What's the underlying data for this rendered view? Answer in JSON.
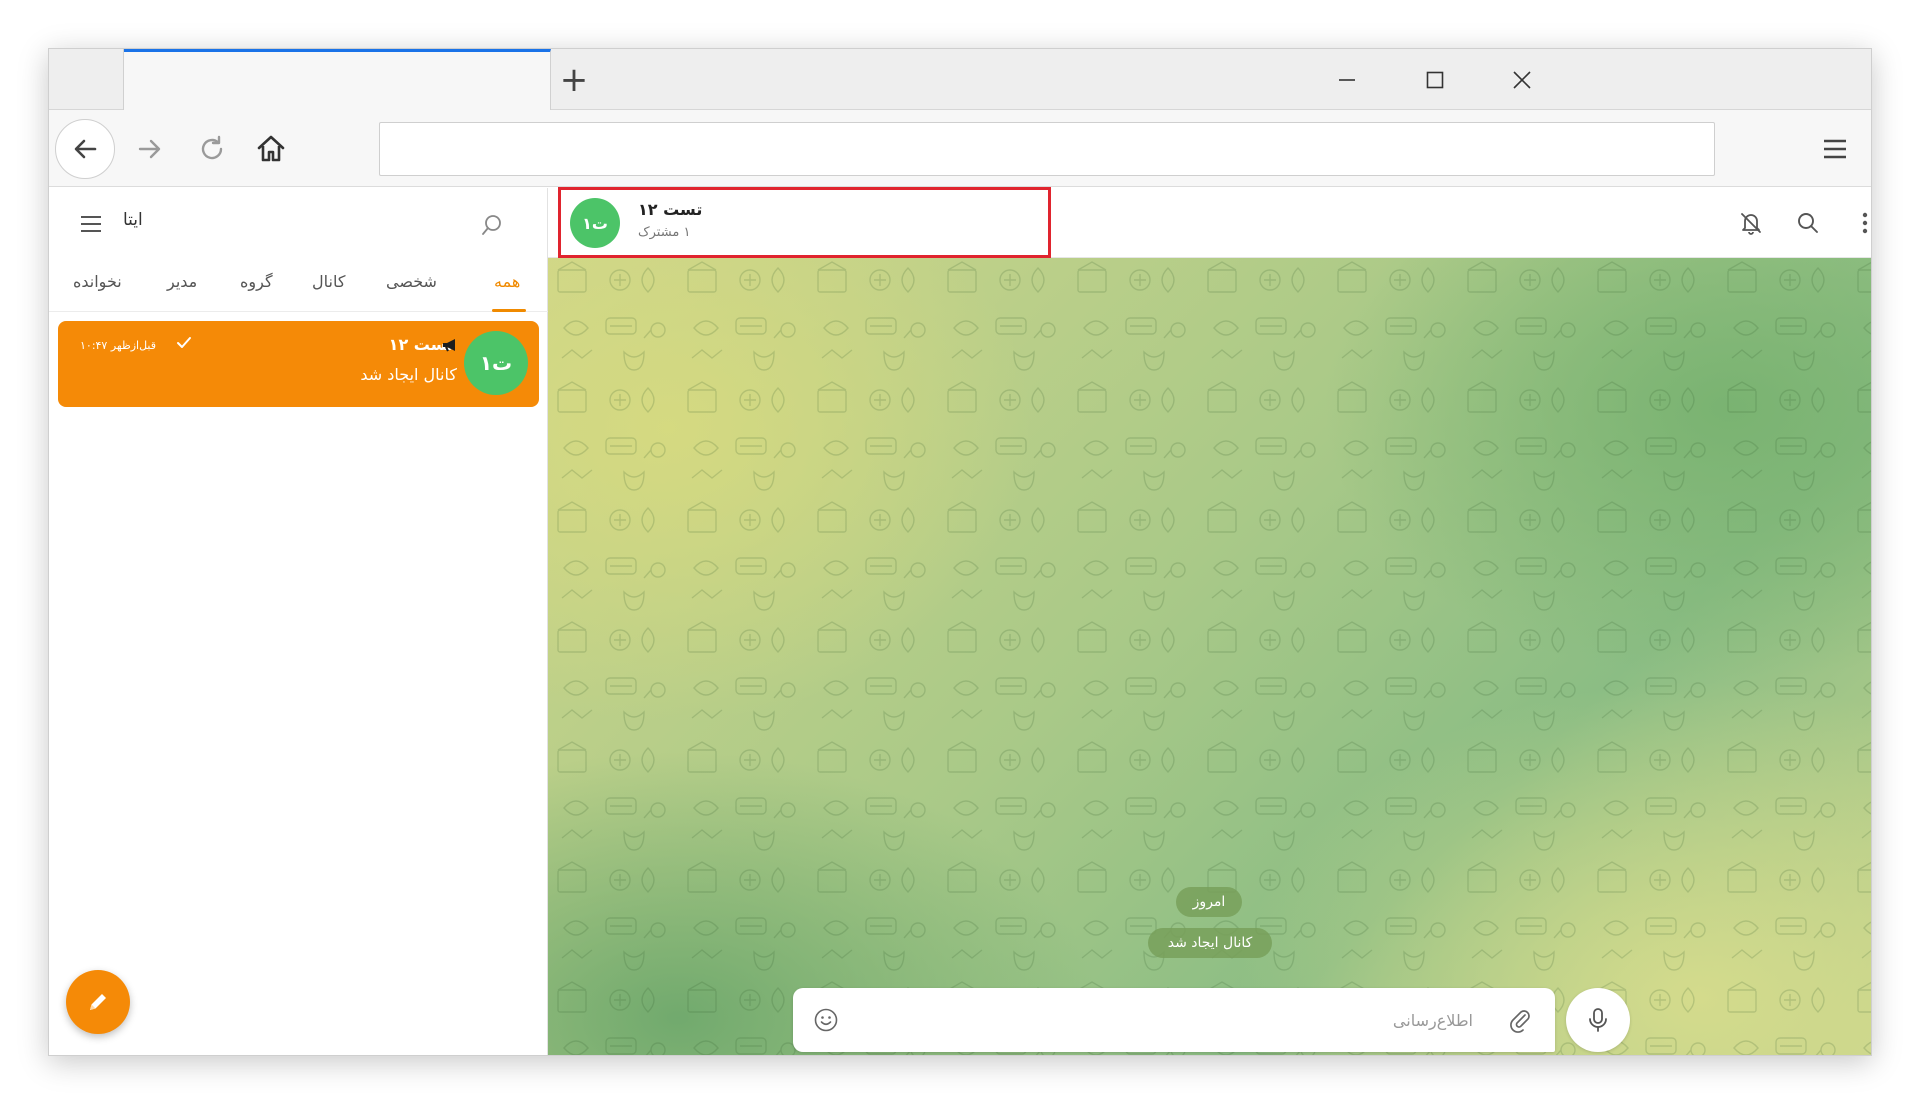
{
  "browser": {
    "new_tab_symbol": "+",
    "url_value": "",
    "icons": [
      "back-arrow-icon",
      "forward-arrow-icon",
      "reload-icon",
      "home-icon",
      "hamburger-menu-icon",
      "minimize-icon",
      "maximize-icon",
      "close-icon"
    ]
  },
  "sidebar": {
    "app_title": "ایتا",
    "tabs": [
      {
        "label": "همه",
        "active": true
      },
      {
        "label": "شخصی",
        "active": false
      },
      {
        "label": "کانال",
        "active": false
      },
      {
        "label": "گروه",
        "active": false
      },
      {
        "label": "مدیر",
        "active": false
      },
      {
        "label": "نخوانده",
        "active": false
      }
    ],
    "chats": [
      {
        "avatar_text": "ت۱",
        "title": "تست ۱۲",
        "last_message": "کانال ایجاد شد",
        "time": "۱۰:۴۷ قبل‌ازظهر",
        "is_channel": true,
        "sent": true
      }
    ]
  },
  "chat": {
    "avatar_text": "ت۱",
    "title": "تست ۱۲",
    "subtitle": "۱ مشترک",
    "date_label": "امروز",
    "service_message": "کانال ایجاد شد",
    "composer_placeholder": "اطلاع‌رسانی"
  },
  "colors": {
    "accent": "#f58a07",
    "avatar": "#4cc468",
    "highlight_box": "#e0242e",
    "tab_active_indicator": "#1a73e8"
  }
}
